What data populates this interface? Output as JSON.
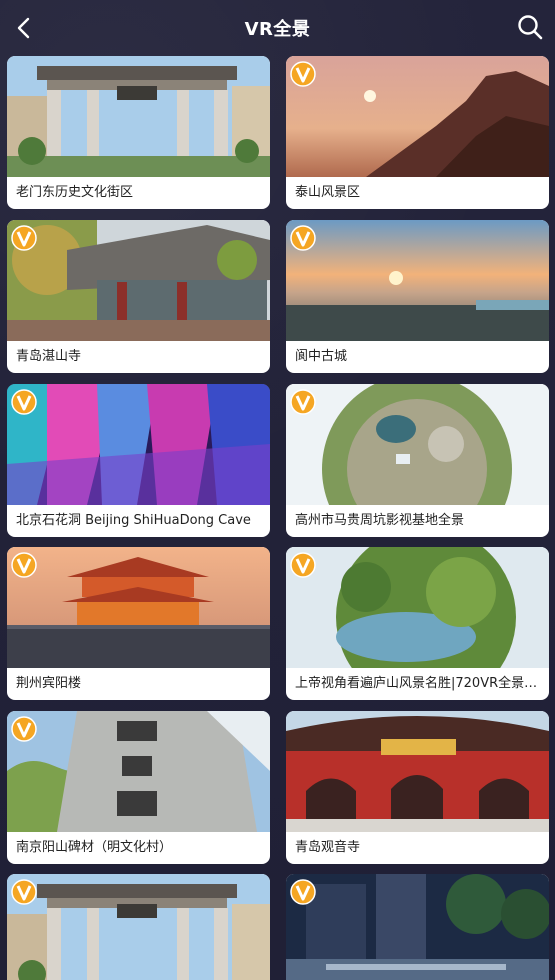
{
  "header": {
    "title": "VR全景",
    "back_icon": "chevron-left-icon",
    "search_icon": "search-icon"
  },
  "badge_icon": "vr-v-badge-icon",
  "cards": [
    {
      "label": "老门东历史文化街区",
      "has_badge": false
    },
    {
      "label": "泰山风景区",
      "has_badge": true
    },
    {
      "label": "青岛湛山寺",
      "has_badge": true
    },
    {
      "label": "阆中古城",
      "has_badge": true
    },
    {
      "label": "北京石花洞 Beijing ShiHuaDong Cave",
      "has_badge": true
    },
    {
      "label": "高州市马贵周坑影视基地全景",
      "has_badge": true
    },
    {
      "label": "荆州宾阳楼",
      "has_badge": true
    },
    {
      "label": "上帝视角看遍庐山风景名胜|720VR全景…",
      "has_badge": true
    },
    {
      "label": "南京阳山碑材（明文化村）",
      "has_badge": true
    },
    {
      "label": "青岛观音寺",
      "has_badge": false
    },
    {
      "label": "",
      "has_badge": true
    },
    {
      "label": "",
      "has_badge": true
    }
  ]
}
